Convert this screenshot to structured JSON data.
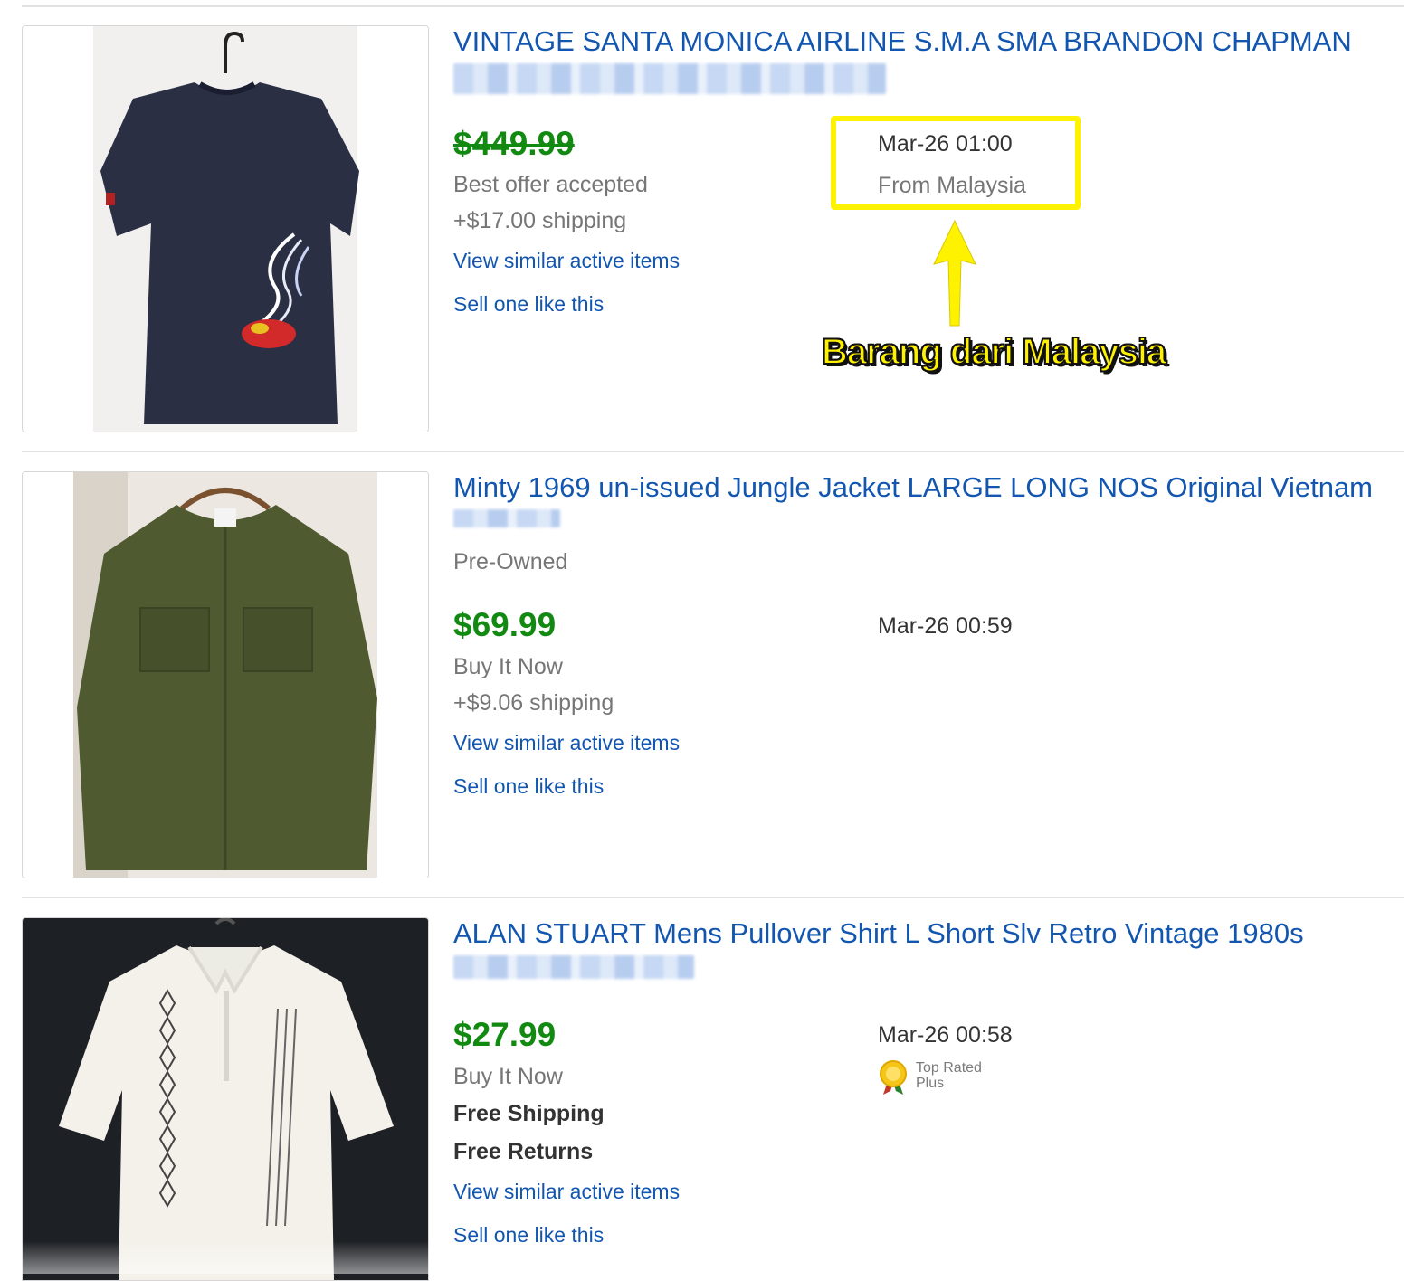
{
  "listings": [
    {
      "title": "VINTAGE SANTA MONICA AIRLINE S.M.A SMA BRANDON CHAPMAN",
      "price": "$449.99",
      "price_status": "sold",
      "purchase_type": "Best offer accepted",
      "shipping": "+$17.00 shipping",
      "view_similar": "View similar active items",
      "sell_one": "Sell one like this",
      "date": "Mar-26 01:00",
      "location": "From Malaysia",
      "image_icon": "navy-tshirt-image"
    },
    {
      "title": "Minty 1969 un-issued Jungle Jacket LARGE LONG NOS Original Vietnam",
      "condition": "Pre-Owned",
      "price": "$69.99",
      "purchase_type": "Buy It Now",
      "shipping": "+$9.06 shipping",
      "view_similar": "View similar active items",
      "sell_one": "Sell one like this",
      "date": "Mar-26 00:59",
      "image_icon": "olive-jacket-image"
    },
    {
      "title": "ALAN STUART Mens Pullover Shirt L Short Slv Retro Vintage 1980s",
      "price": "$27.99",
      "purchase_type": "Buy It Now",
      "shipping": "Free Shipping",
      "returns": "Free Returns",
      "view_similar": "View similar active items",
      "sell_one": "Sell one like this",
      "date": "Mar-26 00:58",
      "badge_line1": "Top Rated",
      "badge_line2": "Plus",
      "image_icon": "white-polo-image"
    }
  ],
  "annotation": {
    "text": "Barang dari Malaysia",
    "color": "#fff200"
  },
  "colors": {
    "link": "#1256b0",
    "price": "#128a12",
    "muted": "#767676"
  }
}
